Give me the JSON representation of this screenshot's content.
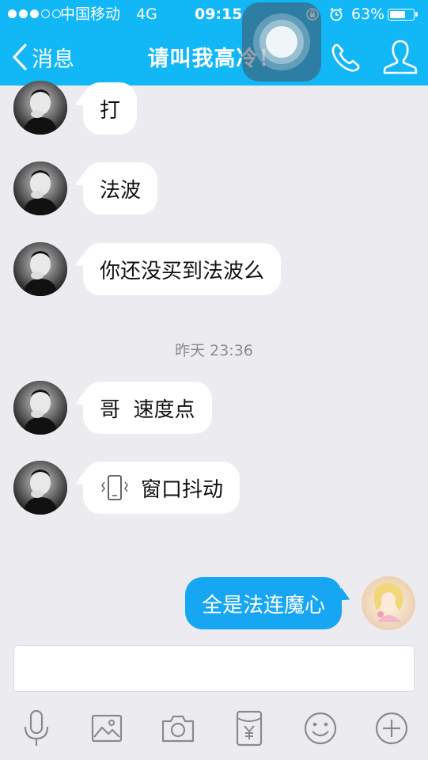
{
  "status_bar": {
    "carrier": "中国移动",
    "network": "4G",
    "time": "09:15",
    "battery": "63%"
  },
  "header": {
    "back_label": "消息",
    "title": "请叫我高冷！"
  },
  "messages": [
    {
      "text": "打"
    },
    {
      "text": "法波"
    },
    {
      "text": "你还没买到法波么"
    },
    {
      "text": "哥  速度点"
    },
    {
      "text": "窗口抖动"
    },
    {
      "text": "全是法连魔心"
    }
  ],
  "timestamp": "昨天 23:36",
  "colors": {
    "header": "#12b7f5",
    "outgoing_bubble": "#17a6f2",
    "background": "#ebebf0"
  },
  "toolbar_icons": [
    "mic-icon",
    "image-icon",
    "camera-icon",
    "red-packet-icon",
    "emoji-icon",
    "plus-icon"
  ]
}
